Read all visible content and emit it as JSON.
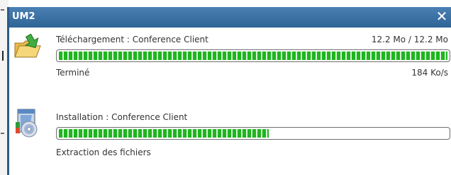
{
  "window": {
    "title": "UM2",
    "close_glyph": "✕"
  },
  "download": {
    "label": "Téléchargement : Conference Client",
    "size": "12.2 Mo / 12.2 Mo",
    "progress_fraction": 1.0,
    "status": "Terminé",
    "speed": "184 Ko/s",
    "icon": "folder-download-icon"
  },
  "install": {
    "label": "Installation : Conference Client",
    "progress_fraction": 0.54,
    "status": "Extraction des fichiers",
    "icon": "installer-disc-icon"
  },
  "colors": {
    "titlebar": "#3a6fa3",
    "progress": "#1fb51f"
  }
}
